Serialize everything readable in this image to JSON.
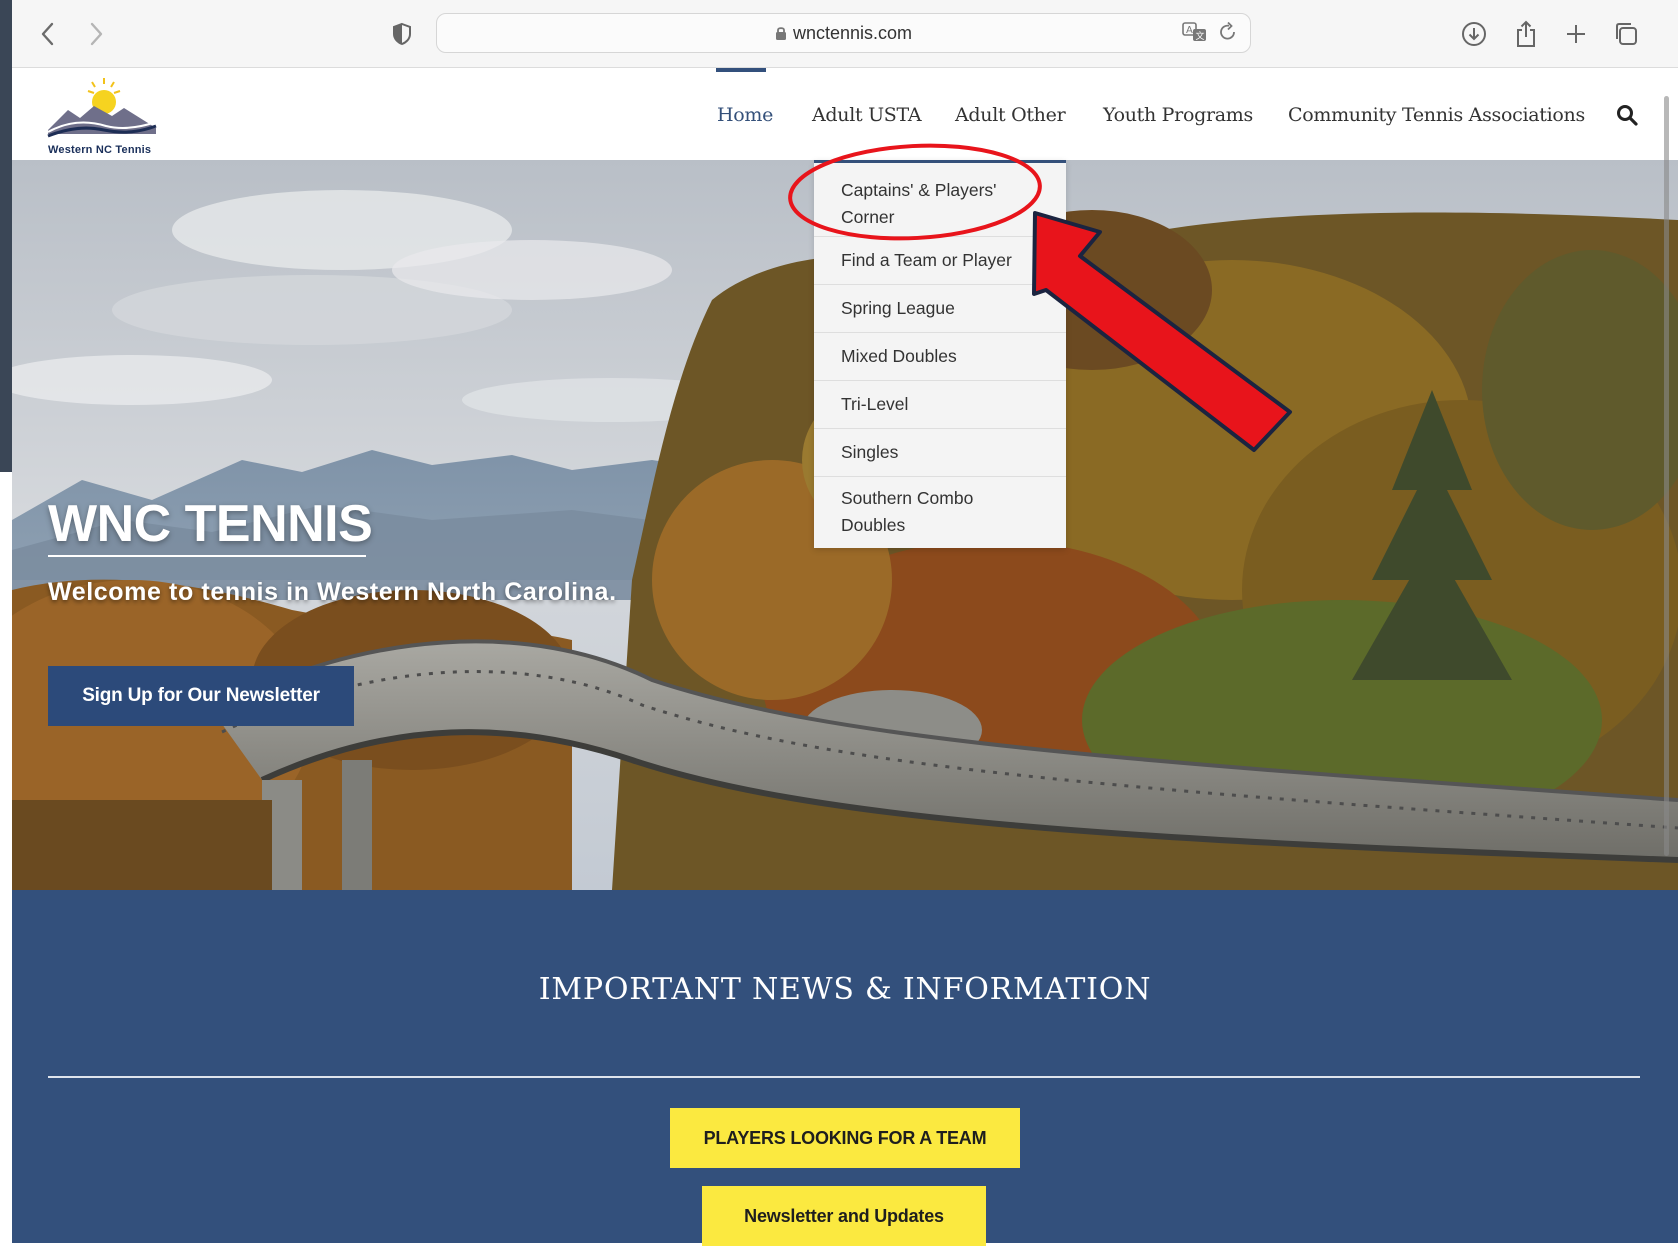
{
  "browser": {
    "url": "wnctennis.com"
  },
  "site": {
    "logo_text": "Western NC Tennis",
    "nav": [
      {
        "label": "Home",
        "active": true
      },
      {
        "label": "Adult USTA",
        "active": false
      },
      {
        "label": "Adult Other",
        "active": false
      },
      {
        "label": "Youth Programs",
        "active": false
      },
      {
        "label": "Community Tennis Associations",
        "active": false
      }
    ],
    "dropdown": {
      "items": [
        {
          "label": "Captains' & Players' Corner"
        },
        {
          "label": "Find a Team or Player"
        },
        {
          "label": "Spring League"
        },
        {
          "label": "Mixed Doubles"
        },
        {
          "label": "Tri-Level"
        },
        {
          "label": "Singles"
        },
        {
          "label": "Southern Combo Doubles"
        }
      ]
    }
  },
  "hero": {
    "title": "WNC TENNIS",
    "subtitle": "Welcome to tennis in Western North Carolina.",
    "button_label": "Sign Up for Our Newsletter"
  },
  "news": {
    "title": "IMPORTANT NEWS & INFORMATION",
    "buttons": [
      {
        "label": "PLAYERS LOOKING FOR A TEAM"
      },
      {
        "label": "Newsletter and Updates"
      }
    ]
  },
  "colors": {
    "brand_blue": "#33507c",
    "button_yellow": "#fbe940",
    "annotation_red": "#e8141b"
  }
}
